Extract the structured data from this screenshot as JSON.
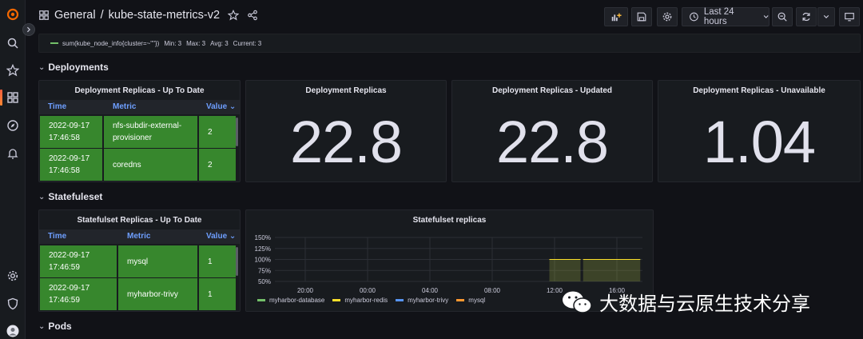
{
  "header": {
    "folder": "General",
    "separator": "/",
    "dashboard_title": "kube-state-metrics-v2",
    "time_range": "Last 24 hours"
  },
  "top_legend": {
    "series": "sum(kube_node_info{cluster=~\"\"})",
    "min": "Min: 3",
    "max": "Max: 3",
    "avg": "Avg: 3",
    "current": "Current: 3",
    "color": "#73bf69"
  },
  "rows": {
    "deployments": "Deployments",
    "statefulset": "Statefuleset",
    "pods": "Pods"
  },
  "deployment_table": {
    "title": "Deployment Replicas - Up To Date",
    "columns": [
      "Time",
      "Metric",
      "Value"
    ],
    "rows": [
      {
        "time": "2022-09-17 17:46:58",
        "metric": "nfs-subdir-external-provisioner",
        "value": "2"
      },
      {
        "time": "2022-09-17 17:46:58",
        "metric": "coredns",
        "value": "2"
      }
    ]
  },
  "stats": [
    {
      "title": "Deployment Replicas",
      "value": "22.8"
    },
    {
      "title": "Deployment Replicas - Updated",
      "value": "22.8"
    },
    {
      "title": "Deployment Replicas - Unavailable",
      "value": "1.04"
    }
  ],
  "statefulset_table": {
    "title": "Statefulset Replicas - Up To Date",
    "columns": [
      "Time",
      "Metric",
      "Value"
    ],
    "rows": [
      {
        "time": "2022-09-17 17:46:59",
        "metric": "mysql",
        "value": "1"
      },
      {
        "time": "2022-09-17 17:46:59",
        "metric": "myharbor-trivy",
        "value": "1"
      }
    ]
  },
  "statefulset_chart": {
    "title": "Statefulset replicas"
  },
  "chart_data": {
    "type": "area",
    "title": "Statefulset replicas",
    "x_ticks": [
      "20:00",
      "00:00",
      "04:00",
      "08:00",
      "12:00",
      "16:00"
    ],
    "y_ticks": [
      "150%",
      "125%",
      "100%",
      "75%",
      "50%"
    ],
    "ylim": [
      50,
      150
    ],
    "grid": true,
    "legend_placement": "bottom",
    "series": [
      {
        "name": "myharbor-database",
        "color": "#73bf69",
        "x": [
          "11:40",
          "13:40",
          "13:50",
          "17:30"
        ],
        "values": [
          100,
          100,
          100,
          100
        ]
      },
      {
        "name": "myharbor-redis",
        "color": "#fade2a",
        "x": [
          "11:40",
          "13:40",
          "13:50",
          "17:30"
        ],
        "values": [
          100,
          100,
          100,
          100
        ]
      },
      {
        "name": "myharbor-trivy",
        "color": "#5794f2",
        "x": [],
        "values": []
      },
      {
        "name": "mysql",
        "color": "#ff9830",
        "x": [],
        "values": []
      }
    ]
  },
  "watermark": "大数据与云原生技术分享",
  "colors": {
    "cell_green": "#37872d",
    "accent_blue": "#6e9fff",
    "background": "#111217",
    "panel": "#181b1f"
  }
}
